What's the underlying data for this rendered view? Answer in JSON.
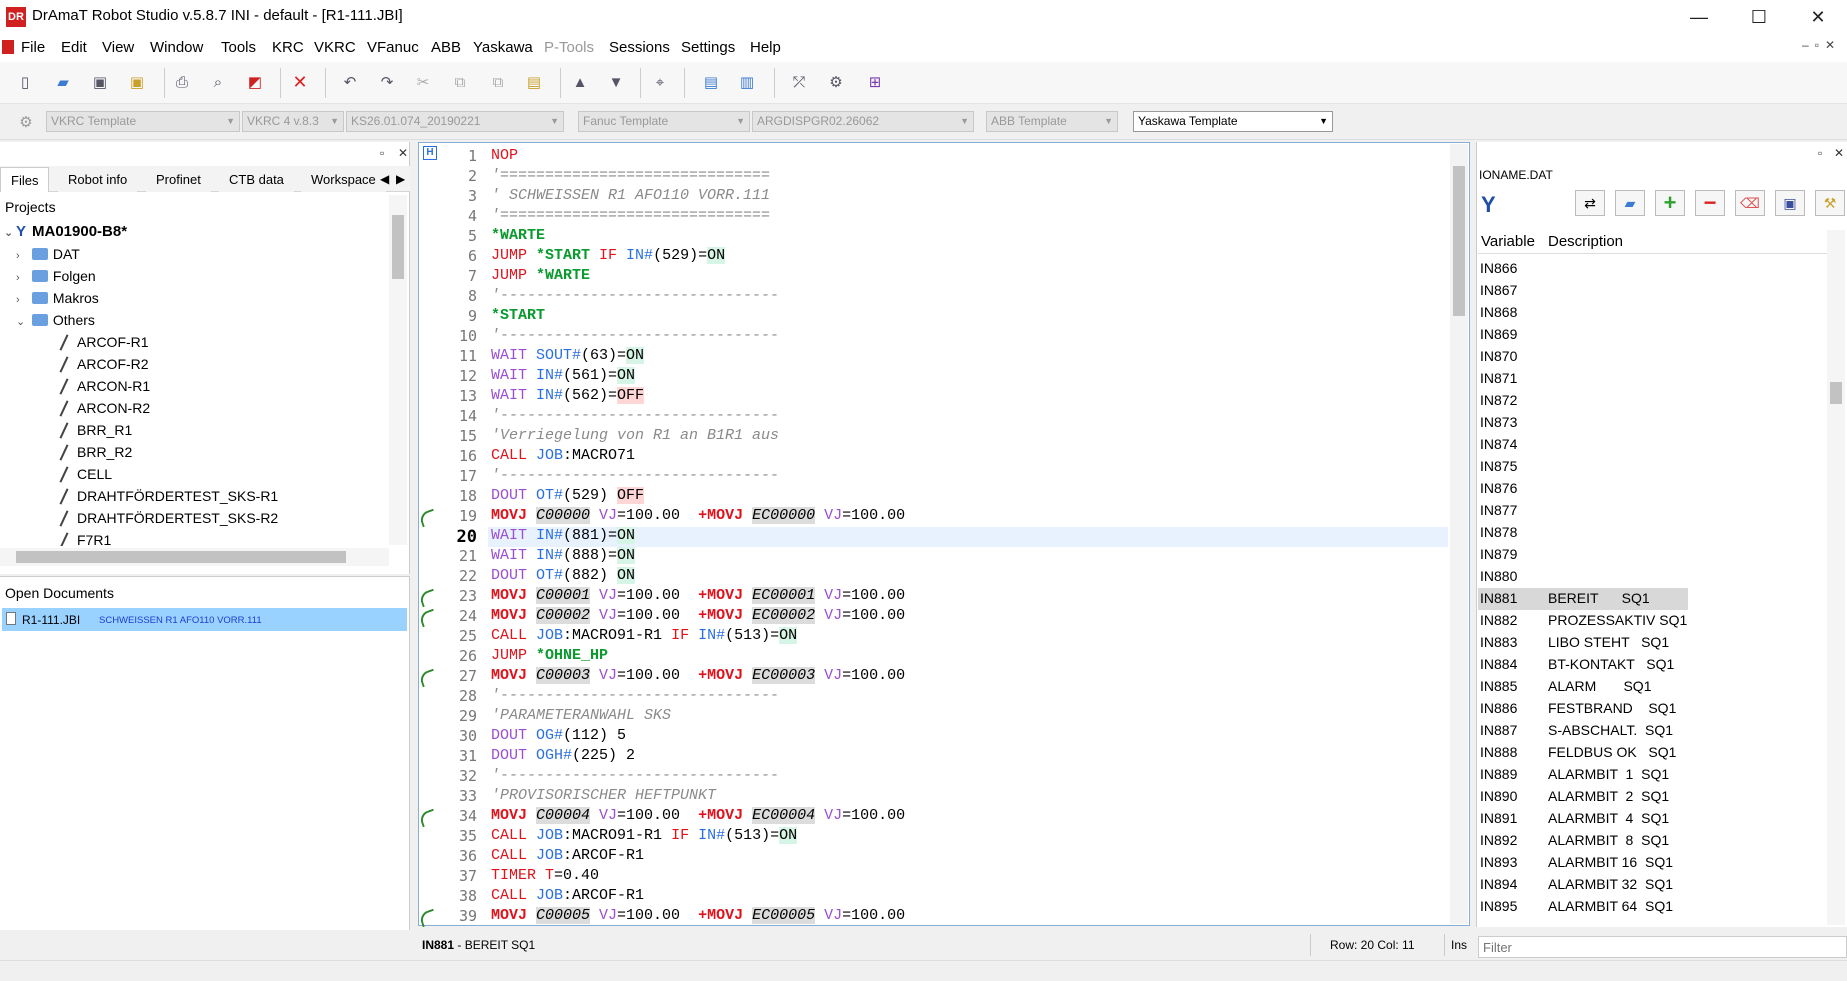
{
  "window": {
    "title": "DrAmaT Robot Studio v.5.8.7 INI - default - [R1-111.JBI]",
    "icon_text": "DR",
    "minimize": "—",
    "maximize": "☐",
    "close": "✕"
  },
  "menu": [
    "File",
    "Edit",
    "View",
    "Window",
    "Tools",
    "KRC",
    "VKRC",
    "VFanuc",
    "ABB",
    "Yaskawa",
    "P-Tools",
    "Sessions",
    "Settings",
    "Help"
  ],
  "templates": {
    "vkrc": "VKRC Template",
    "vkrc_ver": "VKRC 4 v.8.3",
    "krc": "KS26.01.074_20190221",
    "fanuc": "Fanuc Template",
    "fanuc_ver": "ARGDISPGR02.26062",
    "abb": "ABB Template",
    "yaskawa": "Yaskawa Template"
  },
  "left": {
    "tabs": [
      "Files",
      "Robot info",
      "Profinet",
      "CTB data",
      "Workspace"
    ],
    "projects_label": "Projects",
    "project": "MA01900-B8*",
    "folders": [
      "DAT",
      "Folgen",
      "Makros",
      "Others"
    ],
    "files": [
      "ARCOF-R1",
      "ARCOF-R2",
      "ARCON-R1",
      "ARCON-R2",
      "BRR_R1",
      "BRR_R2",
      "CELL",
      "DRAHTFÖRDERTEST_SKS-R1",
      "DRAHTFÖRDERTEST_SKS-R2",
      "F7R1"
    ],
    "open_docs_label": "Open Documents",
    "open_doc_name": "R1-111.JBI",
    "open_doc_desc": "SCHWEISSEN R1 AFO110 VORR.111"
  },
  "right": {
    "file": "IONAME.DAT",
    "col_variable": "Variable",
    "col_description": "Description",
    "rows": [
      [
        "IN866",
        ""
      ],
      [
        "IN867",
        ""
      ],
      [
        "IN868",
        ""
      ],
      [
        "IN869",
        ""
      ],
      [
        "IN870",
        ""
      ],
      [
        "IN871",
        ""
      ],
      [
        "IN872",
        ""
      ],
      [
        "IN873",
        ""
      ],
      [
        "IN874",
        ""
      ],
      [
        "IN875",
        ""
      ],
      [
        "IN876",
        ""
      ],
      [
        "IN877",
        ""
      ],
      [
        "IN878",
        ""
      ],
      [
        "IN879",
        ""
      ],
      [
        "IN880",
        ""
      ],
      [
        "IN881",
        "BEREIT      SQ1"
      ],
      [
        "IN882",
        "PROZESSAKTIV SQ1"
      ],
      [
        "IN883",
        "LIBO STEHT   SQ1"
      ],
      [
        "IN884",
        "BT-KONTAKT   SQ1"
      ],
      [
        "IN885",
        "ALARM       SQ1"
      ],
      [
        "IN886",
        "FESTBRAND    SQ1"
      ],
      [
        "IN887",
        "S-ABSCHALT.  SQ1"
      ],
      [
        "IN888",
        "FELDBUS OK   SQ1"
      ],
      [
        "IN889",
        "ALARMBIT  1  SQ1"
      ],
      [
        "IN890",
        "ALARMBIT  2  SQ1"
      ],
      [
        "IN891",
        "ALARMBIT  4  SQ1"
      ],
      [
        "IN892",
        "ALARMBIT  8  SQ1"
      ],
      [
        "IN893",
        "ALARMBIT 16  SQ1"
      ],
      [
        "IN894",
        "ALARMBIT 32  SQ1"
      ],
      [
        "IN895",
        "ALARMBIT 64  SQ1"
      ]
    ],
    "filter_placeholder": "Filter"
  },
  "status": {
    "left": "IN881",
    "left_desc": " - BEREIT SQ1",
    "rowcol": "Row: 20 Col: 11",
    "mode": "Ins"
  }
}
